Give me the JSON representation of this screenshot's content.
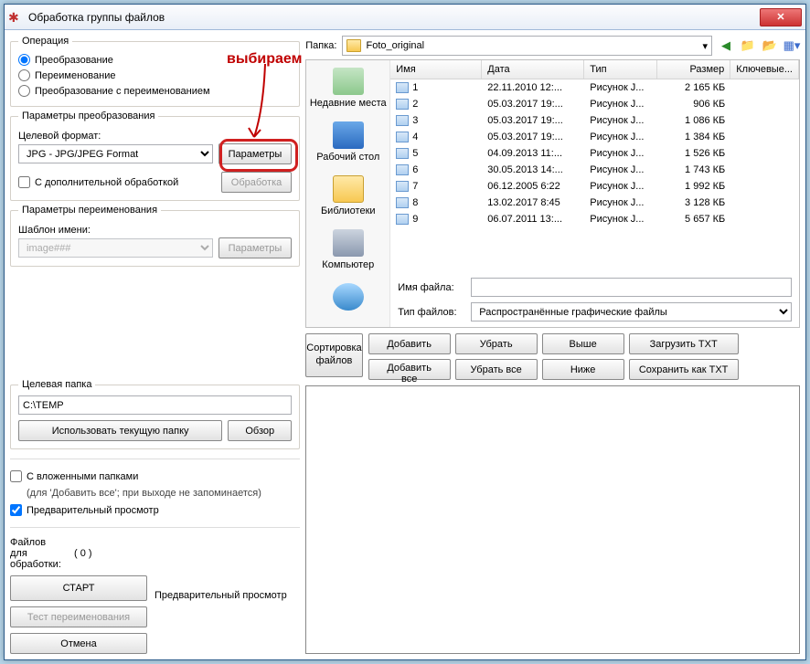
{
  "title": "Обработка группы файлов",
  "annotation": "выбираем",
  "operation": {
    "legend": "Операция",
    "opt1": "Преобразование",
    "opt2": "Переименование",
    "opt3": "Преобразование с переименованием"
  },
  "transform": {
    "legend": "Параметры преобразования",
    "target_format_label": "Целевой формат:",
    "target_format_value": "JPG - JPG/JPEG Format",
    "params_btn": "Параметры",
    "extra_chk": "С дополнительной обработкой",
    "process_btn": "Обработка"
  },
  "rename": {
    "legend": "Параметры переименования",
    "template_label": "Шаблон имени:",
    "template_value": "image###",
    "params_btn": "Параметры"
  },
  "target_folder": {
    "legend": "Целевая папка",
    "value": "C:\\TEMP",
    "use_current_btn": "Использовать текущую папку",
    "browse_btn": "Обзор"
  },
  "subfolders_chk": "С вложенными папками",
  "subfolders_hint": "(для 'Добавить все'; при выходе не запоминается)",
  "preview_chk": "Предварительный просмотр",
  "files_count_label": "Файлов для обработки:",
  "files_count": "( 0 )",
  "start_btn": "СТАРТ",
  "test_rename_btn": "Тест переименования",
  "cancel_btn": "Отмена",
  "preview_label": "Предварительный просмотр",
  "folder_label": "Папка:",
  "folder_value": "Foto_original",
  "sidebar": {
    "recent": "Недавние места",
    "desktop": "Рабочий стол",
    "libraries": "Библиотеки",
    "computer": "Компьютер",
    "network": ""
  },
  "columns": {
    "name": "Имя",
    "date": "Дата",
    "type": "Тип",
    "size": "Размер",
    "keywords": "Ключевые..."
  },
  "files": [
    {
      "name": "1",
      "date": "22.11.2010 12:...",
      "type": "Рисунок J...",
      "size": "2 165 КБ"
    },
    {
      "name": "2",
      "date": "05.03.2017 19:...",
      "type": "Рисунок J...",
      "size": "906 КБ"
    },
    {
      "name": "3",
      "date": "05.03.2017 19:...",
      "type": "Рисунок J...",
      "size": "1 086 КБ"
    },
    {
      "name": "4",
      "date": "05.03.2017 19:...",
      "type": "Рисунок J...",
      "size": "1 384 КБ"
    },
    {
      "name": "5",
      "date": "04.09.2013 11:...",
      "type": "Рисунок J...",
      "size": "1 526 КБ"
    },
    {
      "name": "6",
      "date": "30.05.2013 14:...",
      "type": "Рисунок J...",
      "size": "1 743 КБ"
    },
    {
      "name": "7",
      "date": "06.12.2005 6:22",
      "type": "Рисунок J...",
      "size": "1 992 КБ"
    },
    {
      "name": "8",
      "date": "13.02.2017 8:45",
      "type": "Рисунок J...",
      "size": "3 128 КБ"
    },
    {
      "name": "9",
      "date": "06.07.2011 13:...",
      "type": "Рисунок J...",
      "size": "5 657 КБ"
    }
  ],
  "file_name_label": "Имя файла:",
  "file_name_value": "",
  "file_type_label": "Тип файлов:",
  "file_type_value": "Распространённые графические файлы",
  "sort_btn": "Сортировка файлов",
  "actions": {
    "add": "Добавить",
    "remove": "Убрать",
    "up": "Выше",
    "load_txt": "Загрузить TXT",
    "add_all": "Добавить все",
    "remove_all": "Убрать все",
    "down": "Ниже",
    "save_txt": "Сохранить как TXT"
  }
}
